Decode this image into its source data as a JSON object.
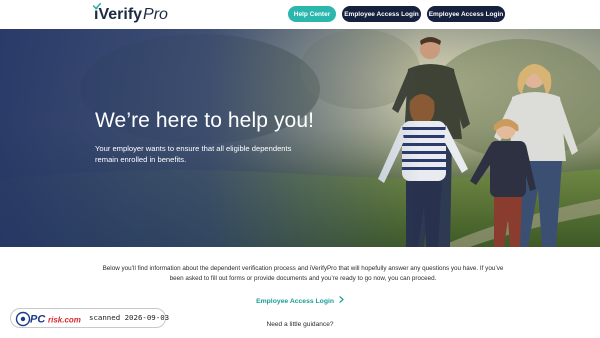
{
  "header": {
    "logo": {
      "brand_prefix": "i",
      "brand_main": "Verify",
      "brand_suffix": "Pro"
    },
    "buttons": {
      "help_center": "Help Center",
      "employee_access_1": "Employee Access Login",
      "employee_access_2": "Employee Access Login"
    }
  },
  "hero": {
    "title": "We’re here to help you!",
    "subtitle": "Your employer wants to ensure that all eligible dependents remain enrolled in benefits."
  },
  "main": {
    "intro": "Below you’ll find information about the dependent verification process and iVerifyPro that will hopefully answer any questions you have. If you’ve been asked to fill out forms or provide documents and you’re ready to go now, you can proceed.",
    "access_link": "Employee Access Login",
    "guidance": "Need a little guidance?"
  },
  "watermark": {
    "logo_text": "PCrisk.com",
    "stamp": "scanned 2026-09-03"
  },
  "colors": {
    "navy": "#16213e",
    "teal": "#2bb7ad",
    "link_teal": "#1a9c94"
  }
}
